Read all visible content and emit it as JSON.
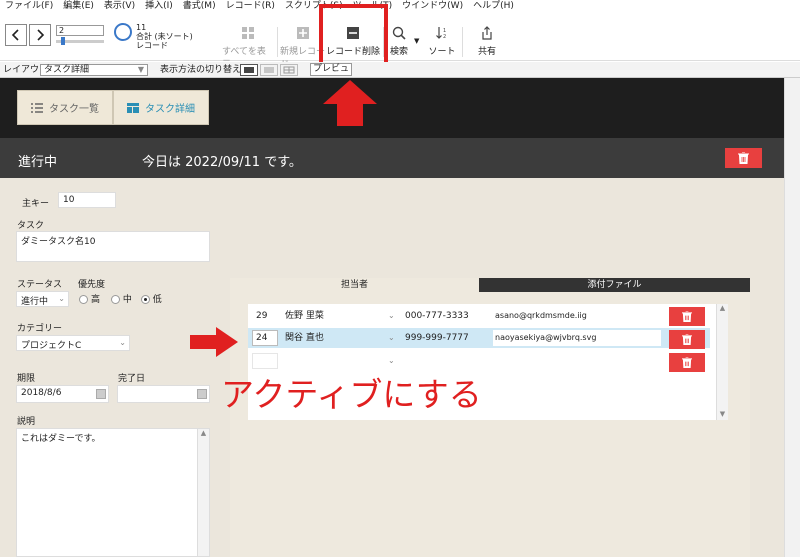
{
  "menu": [
    "ファイル(F)",
    "編集(E)",
    "表示(V)",
    "挿入(I)",
    "書式(M)",
    "レコード(R)",
    "スクリプト(S)",
    "ツール(T)",
    "ウインドウ(W)",
    "ヘルプ(H)"
  ],
  "toolbar": {
    "record_number": "2",
    "record_total": "11",
    "record_sort": "合計 (未ソート)",
    "record_label": "レコード",
    "show_all": "すべてを表示",
    "new_record": "新規レコード",
    "delete_record": "レコード削除",
    "find": "検索",
    "sort": "ソート",
    "share": "共有"
  },
  "layoutbar": {
    "layout_label": "レイアウト:",
    "layout_value": "タスク詳細",
    "view_switch_label": "表示方法の切り替え:",
    "preview": "プレビュー"
  },
  "tabs": {
    "list": "タスク一覧",
    "detail": "タスク詳細"
  },
  "header": {
    "status": "進行中",
    "date_text": "今日は 2022/09/11 です。"
  },
  "form": {
    "primary_key_label": "主キー",
    "primary_key": "10",
    "task_label": "タスク",
    "task_value": "ダミータスク名10",
    "status_label": "ステータス",
    "status_value": "進行中",
    "priority_label": "優先度",
    "priority_high": "高",
    "priority_mid": "中",
    "priority_low": "低",
    "category_label": "カテゴリー",
    "category_value": "プロジェクトC",
    "due_label": "期限",
    "due_value": "2018/8/6",
    "done_label": "完了日",
    "done_value": "",
    "desc_label": "説明",
    "desc_value": "これはダミーです。"
  },
  "portal": {
    "tab_assignee": "担当者",
    "tab_attachment": "添付ファイル",
    "rows": [
      {
        "id": "29",
        "name": "佐野 里菜",
        "phone": "000-777-3333",
        "email": "asano@qrkdmsmde.iig"
      },
      {
        "id": "24",
        "name": "関谷 直也",
        "phone": "999-999-7777",
        "email": "naoyasekiya@wjvbrq.svg"
      }
    ]
  },
  "annotation": {
    "text": "アクティブにする"
  },
  "colors": {
    "accent_red": "#e8403f",
    "annotation_red": "#e02020",
    "active_row": "#cfe8f5",
    "dark_band": "#1e1e1e",
    "header_strip": "#3c3c3c"
  }
}
